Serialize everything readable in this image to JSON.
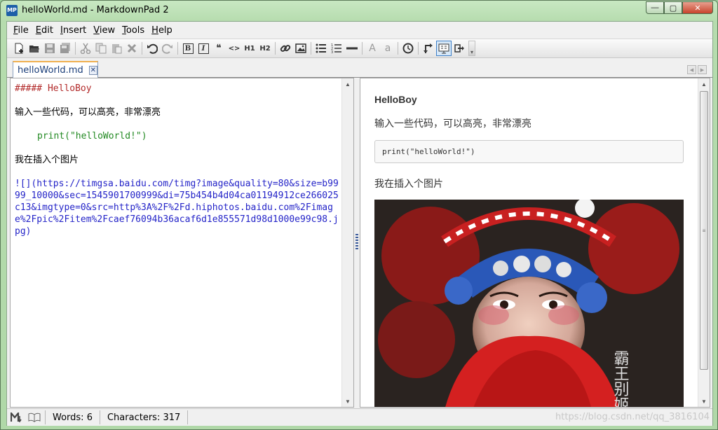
{
  "window": {
    "title": "helloWorld.md - MarkdownPad 2",
    "app_icon_label": "MP",
    "minimize": "—",
    "maximize": "▢",
    "close": "✕"
  },
  "menu": {
    "file": {
      "mnemonic": "F",
      "rest": "ile"
    },
    "edit": {
      "mnemonic": "E",
      "rest": "dit"
    },
    "insert": {
      "mnemonic": "I",
      "rest": "nsert"
    },
    "view": {
      "mnemonic": "V",
      "rest": "iew"
    },
    "tools": {
      "mnemonic": "T",
      "rest": "ools"
    },
    "help": {
      "mnemonic": "H",
      "rest": "elp"
    }
  },
  "toolbar": {
    "bold_label": "B",
    "italic_label": "I",
    "quote_label": "❝",
    "code_label": "<>",
    "h1_label": "H1",
    "h2_label": "H2",
    "uppercase_label": "A",
    "lowercase_label": "a"
  },
  "tabs": [
    {
      "label": "helloWorld.md",
      "close": "✕",
      "active": true
    }
  ],
  "editor": {
    "heading": "##### HelloBoy",
    "para1": "输入一些代码，可以高亮，非常漂亮",
    "code": "print(\"helloWorld!\")",
    "para2": "我在插入个图片",
    "link": "![](https://timgsa.baidu.com/timg?image&quality=80&size=b9999_10000&sec=1545901700999&di=75b454b4d04ca01194912ce266025c13&imgtype=0&src=http%3A%2F%2Fd.hiphotos.baidu.com%2Fimage%2Fpic%2Fitem%2Fcaef76094b36acaf6d1e855571d98d1000e99c98.jpg)"
  },
  "preview": {
    "heading": "HelloBoy",
    "para1": "输入一些代码，可以高亮，非常漂亮",
    "code": "print(\"helloWorld!\")",
    "para2": "我在插入个图片",
    "image_caption": "霸王别姬"
  },
  "status": {
    "words_label": "Words: 6",
    "characters_label": "Characters: 317",
    "watermark": "https://blog.csdn.net/qq_3816104"
  },
  "colors": {
    "heading": "#b22a2a",
    "code": "#238a23",
    "link": "#2424c8",
    "frame": "#b0d8a8"
  }
}
